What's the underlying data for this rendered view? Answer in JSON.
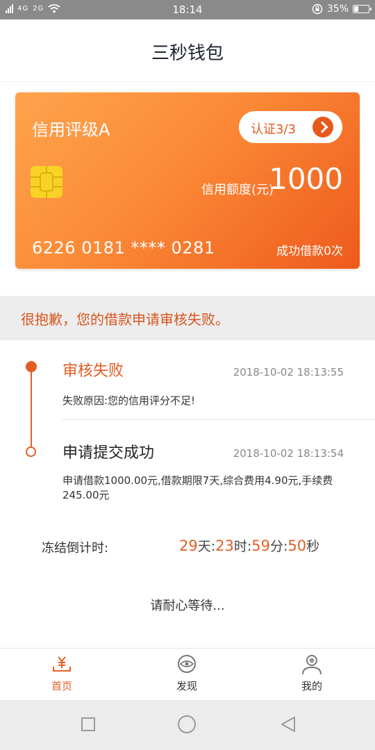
{
  "status_bar": {
    "network": "4G",
    "network2": "2G",
    "time": "18:14",
    "battery": "35%"
  },
  "header": {
    "title": "三秒钱包"
  },
  "card": {
    "rating": "信用评级A",
    "verify_label": "认证3/3",
    "limit_label": "信用额度(元)",
    "limit_value": "1000",
    "card_number": "6226 0181 **** 0281",
    "success_count": "成功借款0次",
    "colors": {
      "gradient_start": "#ffa34d",
      "gradient_end": "#ee5a1c",
      "chip": "#f8d326"
    }
  },
  "banner": {
    "message": "很抱歉，您的借款申请审核失败。"
  },
  "timeline": [
    {
      "title": "审核失败",
      "time": "2018-10-02 18:13:55",
      "detail": "失败原因:您的信用评分不足!"
    },
    {
      "title": "申请提交成功",
      "time": "2018-10-02 18:13:54",
      "detail": "申请借款1000.00元,借款期限7天,综合费用4.90元,手续费245.00元"
    }
  ],
  "countdown": {
    "label": "冻结倒计时:",
    "days": "29",
    "days_unit": "天:",
    "hours": "23",
    "hours_unit": "时:",
    "minutes": "59",
    "minutes_unit": "分:",
    "seconds": "50",
    "seconds_unit": "秒"
  },
  "waiting": "请耐心等待...",
  "tabs": [
    {
      "label": "首页",
      "icon": "yen-home-icon",
      "active": true
    },
    {
      "label": "发现",
      "icon": "discover-eye-icon",
      "active": false
    },
    {
      "label": "我的",
      "icon": "user-profile-icon",
      "active": false
    }
  ],
  "accent_color": "#e25e24"
}
